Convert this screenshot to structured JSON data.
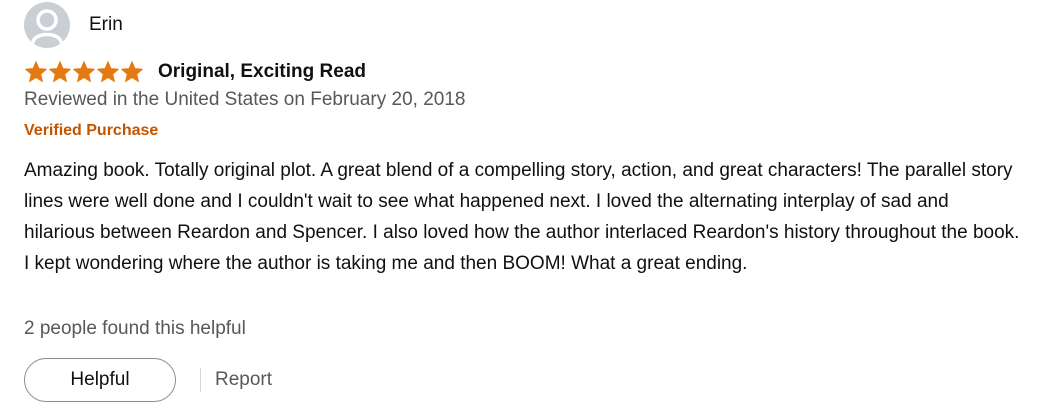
{
  "reviewer": {
    "name": "Erin",
    "avatar_icon": "default-user-icon"
  },
  "rating": {
    "stars": 5,
    "max": 5,
    "star_color": "#e47911"
  },
  "review": {
    "title": "Original, Exciting Read",
    "date_line": "Reviewed in the United States on February 20, 2018",
    "verified_label": "Verified Purchase",
    "body": "Amazing book. Totally original plot. A great blend of a compelling story, action, and great characters! The parallel story lines were well done and I couldn't wait to see what happened next. I loved the alternating interplay of sad and hilarious between Reardon and Spencer. I also loved how the author interlaced Reardon's history throughout the book. I kept wondering where the author is taking me and then BOOM! What a great ending.",
    "helpful_count_text": "2 people found this helpful"
  },
  "actions": {
    "helpful_label": "Helpful",
    "report_label": "Report"
  },
  "colors": {
    "verified": "#c45500",
    "secondary_text": "#565959",
    "avatar_bg": "#c9cfd4"
  }
}
